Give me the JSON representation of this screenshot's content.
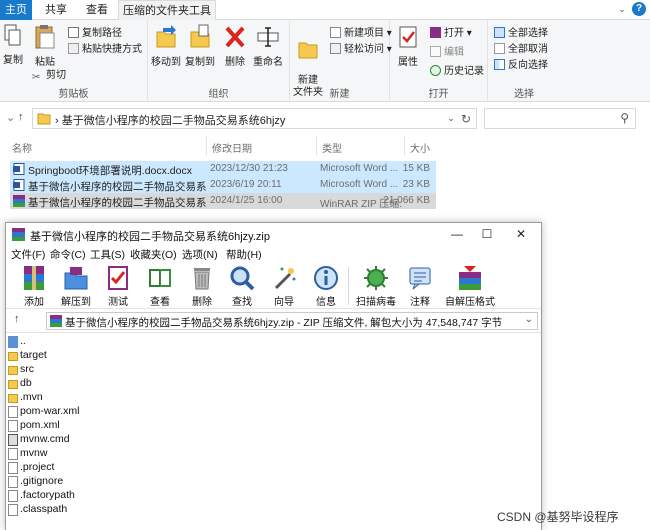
{
  "explorer": {
    "tabs": {
      "file": "主页",
      "share": "共享",
      "view": "查看",
      "tools": "压缩的文件夹工具"
    },
    "ribbon": {
      "clipboard": {
        "label": "剪贴板",
        "copy": "复制",
        "paste": "粘贴",
        "copy_path": "复制路径",
        "paste_shortcut": "粘贴快捷方式",
        "cut": "剪切"
      },
      "organize": {
        "label": "组织",
        "move_to": "移动到",
        "copy_to": "复制到",
        "delete": "删除",
        "rename": "重命名"
      },
      "new": {
        "label": "新建",
        "new_folder": "新建\n文件夹",
        "new_item": "新建项目 ▾",
        "easy_access": "轻松访问 ▾"
      },
      "open": {
        "label": "打开",
        "properties": "属性",
        "open": "打开 ▾",
        "edit": "编辑",
        "history": "历史记录"
      },
      "select": {
        "label": "选择",
        "select_all": "全部选择",
        "select_none": "全部取消",
        "invert": "反向选择"
      }
    },
    "address": {
      "path": "›  基于微信小程序的校园二手物品交易系统6hjzy"
    },
    "columns": {
      "name": "名称",
      "date": "修改日期",
      "type": "类型",
      "size": "大小"
    },
    "files": [
      {
        "name": "Springboot环境部署说明.docx.docx",
        "date": "2023/12/30 21:23",
        "type": "Microsoft Word ...",
        "size": "15 KB"
      },
      {
        "name": "基于微信小程序的校园二手物品交易系统...",
        "date": "2023/6/19 20:11",
        "type": "Microsoft Word ...",
        "size": "23 KB"
      },
      {
        "name": "基于微信小程序的校园二手物品交易系统...",
        "date": "2024/1/25 16:00",
        "type": "WinRAR ZIP 压缩...",
        "size": "21,066 KB"
      }
    ]
  },
  "winrar": {
    "title": "基于微信小程序的校园二手物品交易系统6hjzy.zip",
    "menu": [
      "文件(F)",
      "命令(C)",
      "工具(S)",
      "收藏夹(O)",
      "选项(N)",
      "帮助(H)"
    ],
    "toolbar": [
      "添加",
      "解压到",
      "测试",
      "查看",
      "删除",
      "查找",
      "向导",
      "信息",
      "扫描病毒",
      "注释",
      "自解压格式"
    ],
    "path": "基于微信小程序的校园二手物品交易系统6hjzy.zip - ZIP 压缩文件, 解包大小为 47,548,747 字节",
    "items": [
      "..",
      "target",
      "src",
      "db",
      ".mvn",
      "pom-war.xml",
      "pom.xml",
      "mvnw.cmd",
      "mvnw",
      ".project",
      ".gitignore",
      ".factorypath",
      ".classpath"
    ]
  },
  "watermark": "CSDN @基努毕设程序"
}
